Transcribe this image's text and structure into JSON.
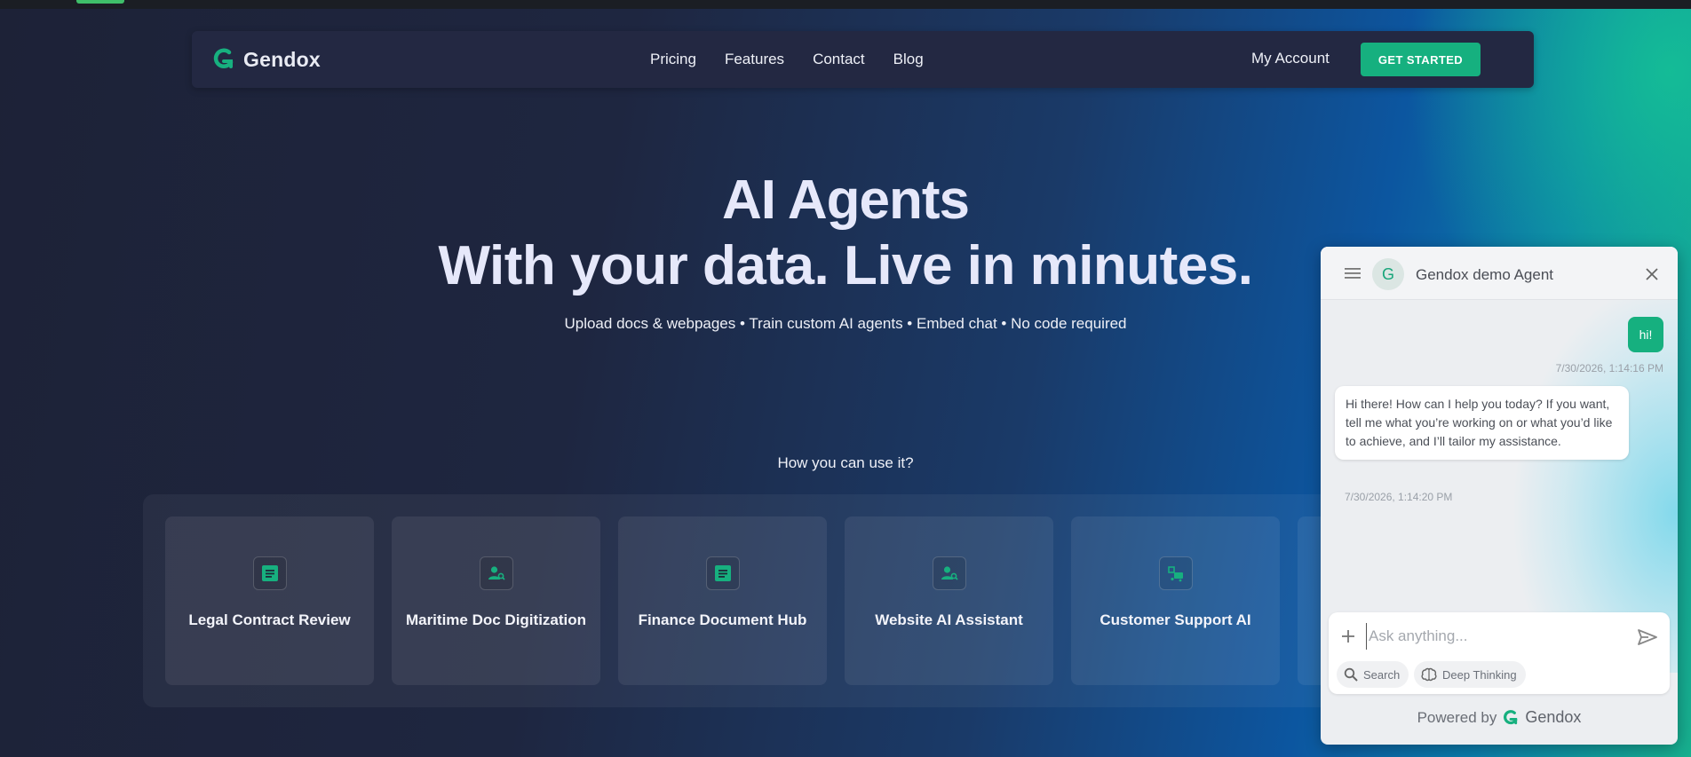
{
  "nav": {
    "brand": "Gendox",
    "links": [
      "Pricing",
      "Features",
      "Contact",
      "Blog"
    ],
    "account": "My Account",
    "cta": "GET STARTED"
  },
  "hero": {
    "line1": "AI Agents",
    "line2": "With your data. Live in minutes.",
    "subtitle": "Upload docs & webpages • Train custom AI agents • Embed chat • No code required"
  },
  "usecases": {
    "heading": "How you can use it?",
    "cards": [
      {
        "label": "Legal Contract Review",
        "icon": "document-icon"
      },
      {
        "label": "Maritime Doc Digitization",
        "icon": "user-search-icon"
      },
      {
        "label": "Finance Document Hub",
        "icon": "document-icon"
      },
      {
        "label": "Website AI Assistant",
        "icon": "user-search-icon"
      },
      {
        "label": "Customer Support AI",
        "icon": "support-icon"
      }
    ]
  },
  "chat": {
    "avatar_letter": "G",
    "agent_name": "Gendox demo Agent",
    "messages": [
      {
        "role": "user",
        "text": "hi!",
        "timestamp": "7/30/2026, 1:14:16 PM"
      },
      {
        "role": "assistant",
        "text": "Hi there! How can I help you today? If you want, tell me what you’re working on or what you’d like to achieve, and I’ll tailor my assistance.",
        "timestamp": "7/30/2026, 1:14:20 PM"
      }
    ],
    "input_placeholder": "Ask anything...",
    "chips": [
      "Search",
      "Deep Thinking"
    ],
    "powered_by": "Powered by",
    "powered_brand": "Gendox"
  },
  "colors": {
    "accent": "#16b07f",
    "navbar": "#232842",
    "hero_text": "#e6e8fa"
  }
}
